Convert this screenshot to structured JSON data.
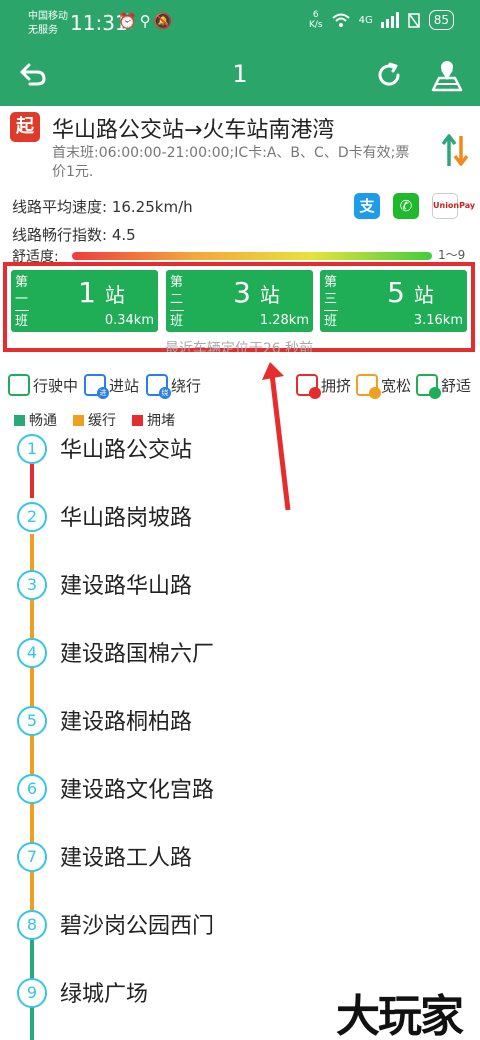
{
  "status_bar": {
    "carrier": "中国移动",
    "service": "无服务",
    "time": "11:31",
    "net_speed_value": "6",
    "net_speed_unit": "K/s",
    "signal": "4G",
    "battery": "85"
  },
  "app_bar": {
    "title": "1"
  },
  "route": {
    "start_badge": "起",
    "name": "华山路公交站→火车站南港湾",
    "info": "首末班:06:00:00-21:00:00;IC卡:A、B、C、D卡有效;票价1元."
  },
  "stats": {
    "speed": "线路平均速度: 16.25km/h",
    "smooth_index": "线路畅行指数: 4.5",
    "comfort_label": "舒适度:",
    "comfort_range": "1～9"
  },
  "payment": {
    "alipay_glyph": "支",
    "wechat_glyph": "✆",
    "unionpay_glyph": "UnionPay"
  },
  "buses": [
    {
      "order_a": "第",
      "order_b": "一",
      "order_c": "班",
      "stops": "1",
      "unit": "站",
      "distance": "0.34km"
    },
    {
      "order_a": "第",
      "order_b": "二",
      "order_c": "班",
      "stops": "3",
      "unit": "站",
      "distance": "1.28km"
    },
    {
      "order_a": "第",
      "order_b": "三",
      "order_c": "班",
      "stops": "5",
      "unit": "站",
      "distance": "3.16km"
    }
  ],
  "bus_note": "最近车辆定位于26 秒前",
  "legend_status": [
    "行驶中",
    "进站",
    "绕行"
  ],
  "legend_crowd": [
    "拥挤",
    "宽松",
    "舒适"
  ],
  "legend_traffic": [
    {
      "label": "畅通",
      "color": "#2aa87a"
    },
    {
      "label": "缓行",
      "color": "#f0a020"
    },
    {
      "label": "拥堵",
      "color": "#e52d2d"
    }
  ],
  "stops": [
    {
      "num": "1",
      "name": "华山路公交站"
    },
    {
      "num": "2",
      "name": "华山路岗坡路"
    },
    {
      "num": "3",
      "name": "建设路华山路"
    },
    {
      "num": "4",
      "name": "建设路国棉六厂"
    },
    {
      "num": "5",
      "name": "建设路桐柏路"
    },
    {
      "num": "6",
      "name": "建设路文化宫路"
    },
    {
      "num": "7",
      "name": "建设路工人路"
    },
    {
      "num": "8",
      "name": "碧沙岗公园西门"
    },
    {
      "num": "9",
      "name": "绿城广场"
    }
  ],
  "watermark": "大玩家",
  "colors": {
    "brand_green": "#2ba56a",
    "highlight_red": "#e52d2d",
    "stop_blue": "#36c5e6"
  }
}
